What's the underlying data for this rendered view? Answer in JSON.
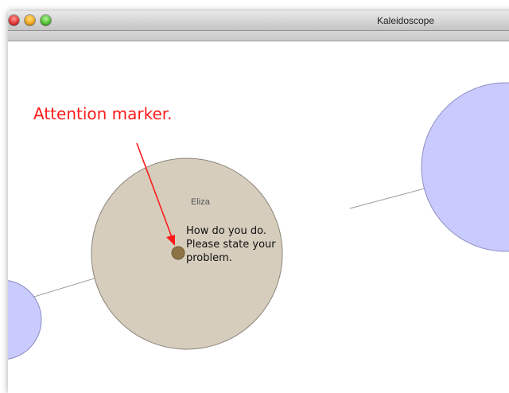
{
  "window": {
    "title": "Kaleidoscope"
  },
  "canvas": {
    "participant": {
      "name": "Eliza",
      "message": "How do you do. Please state your problem."
    }
  },
  "annotation": {
    "text": "Attention marker."
  },
  "colors": {
    "participant_fill": "#d6cdbd",
    "participant_stroke": "#8a847a",
    "other_fill": "#c9cbff",
    "other_stroke": "#8a8cc2",
    "marker": "#8c7346",
    "annotation": "#ff1a1a",
    "connector_line": "#9a9a9a"
  },
  "icons": {
    "close": "close-button-icon",
    "minimize": "minimize-button-icon",
    "maximize": "zoom-button-icon"
  }
}
